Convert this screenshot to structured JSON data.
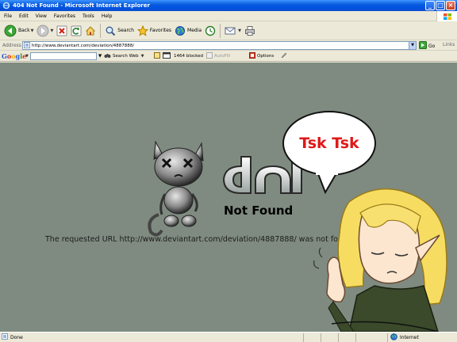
{
  "window": {
    "title": "404 Not Found - Microsoft Internet Explorer"
  },
  "menu": [
    "File",
    "Edit",
    "View",
    "Favorites",
    "Tools",
    "Help"
  ],
  "toolbar": {
    "back": "Back",
    "search": "Search",
    "favorites": "Favorites",
    "media": "Media"
  },
  "address": {
    "label": "Address",
    "url": "http://www.deviantart.com/deviation/4887888/",
    "go": "Go",
    "links": "Links"
  },
  "google_bar": {
    "logo": "Google",
    "search_web": "Search Web",
    "blocked": "1464 blocked",
    "autofill": "AutoFill",
    "options": "Options"
  },
  "page": {
    "heading": "Not Found",
    "message": "The requested URL http://www.deviantart.com/deviation/4887888/ was not found on this server.",
    "speech": "Tsk Tsk"
  },
  "status": {
    "text": "Done",
    "zone": "Internet"
  },
  "colors": {
    "page_bg": "#7f8b80",
    "titlebar": "#0054e3",
    "speech_text": "#e01818"
  }
}
